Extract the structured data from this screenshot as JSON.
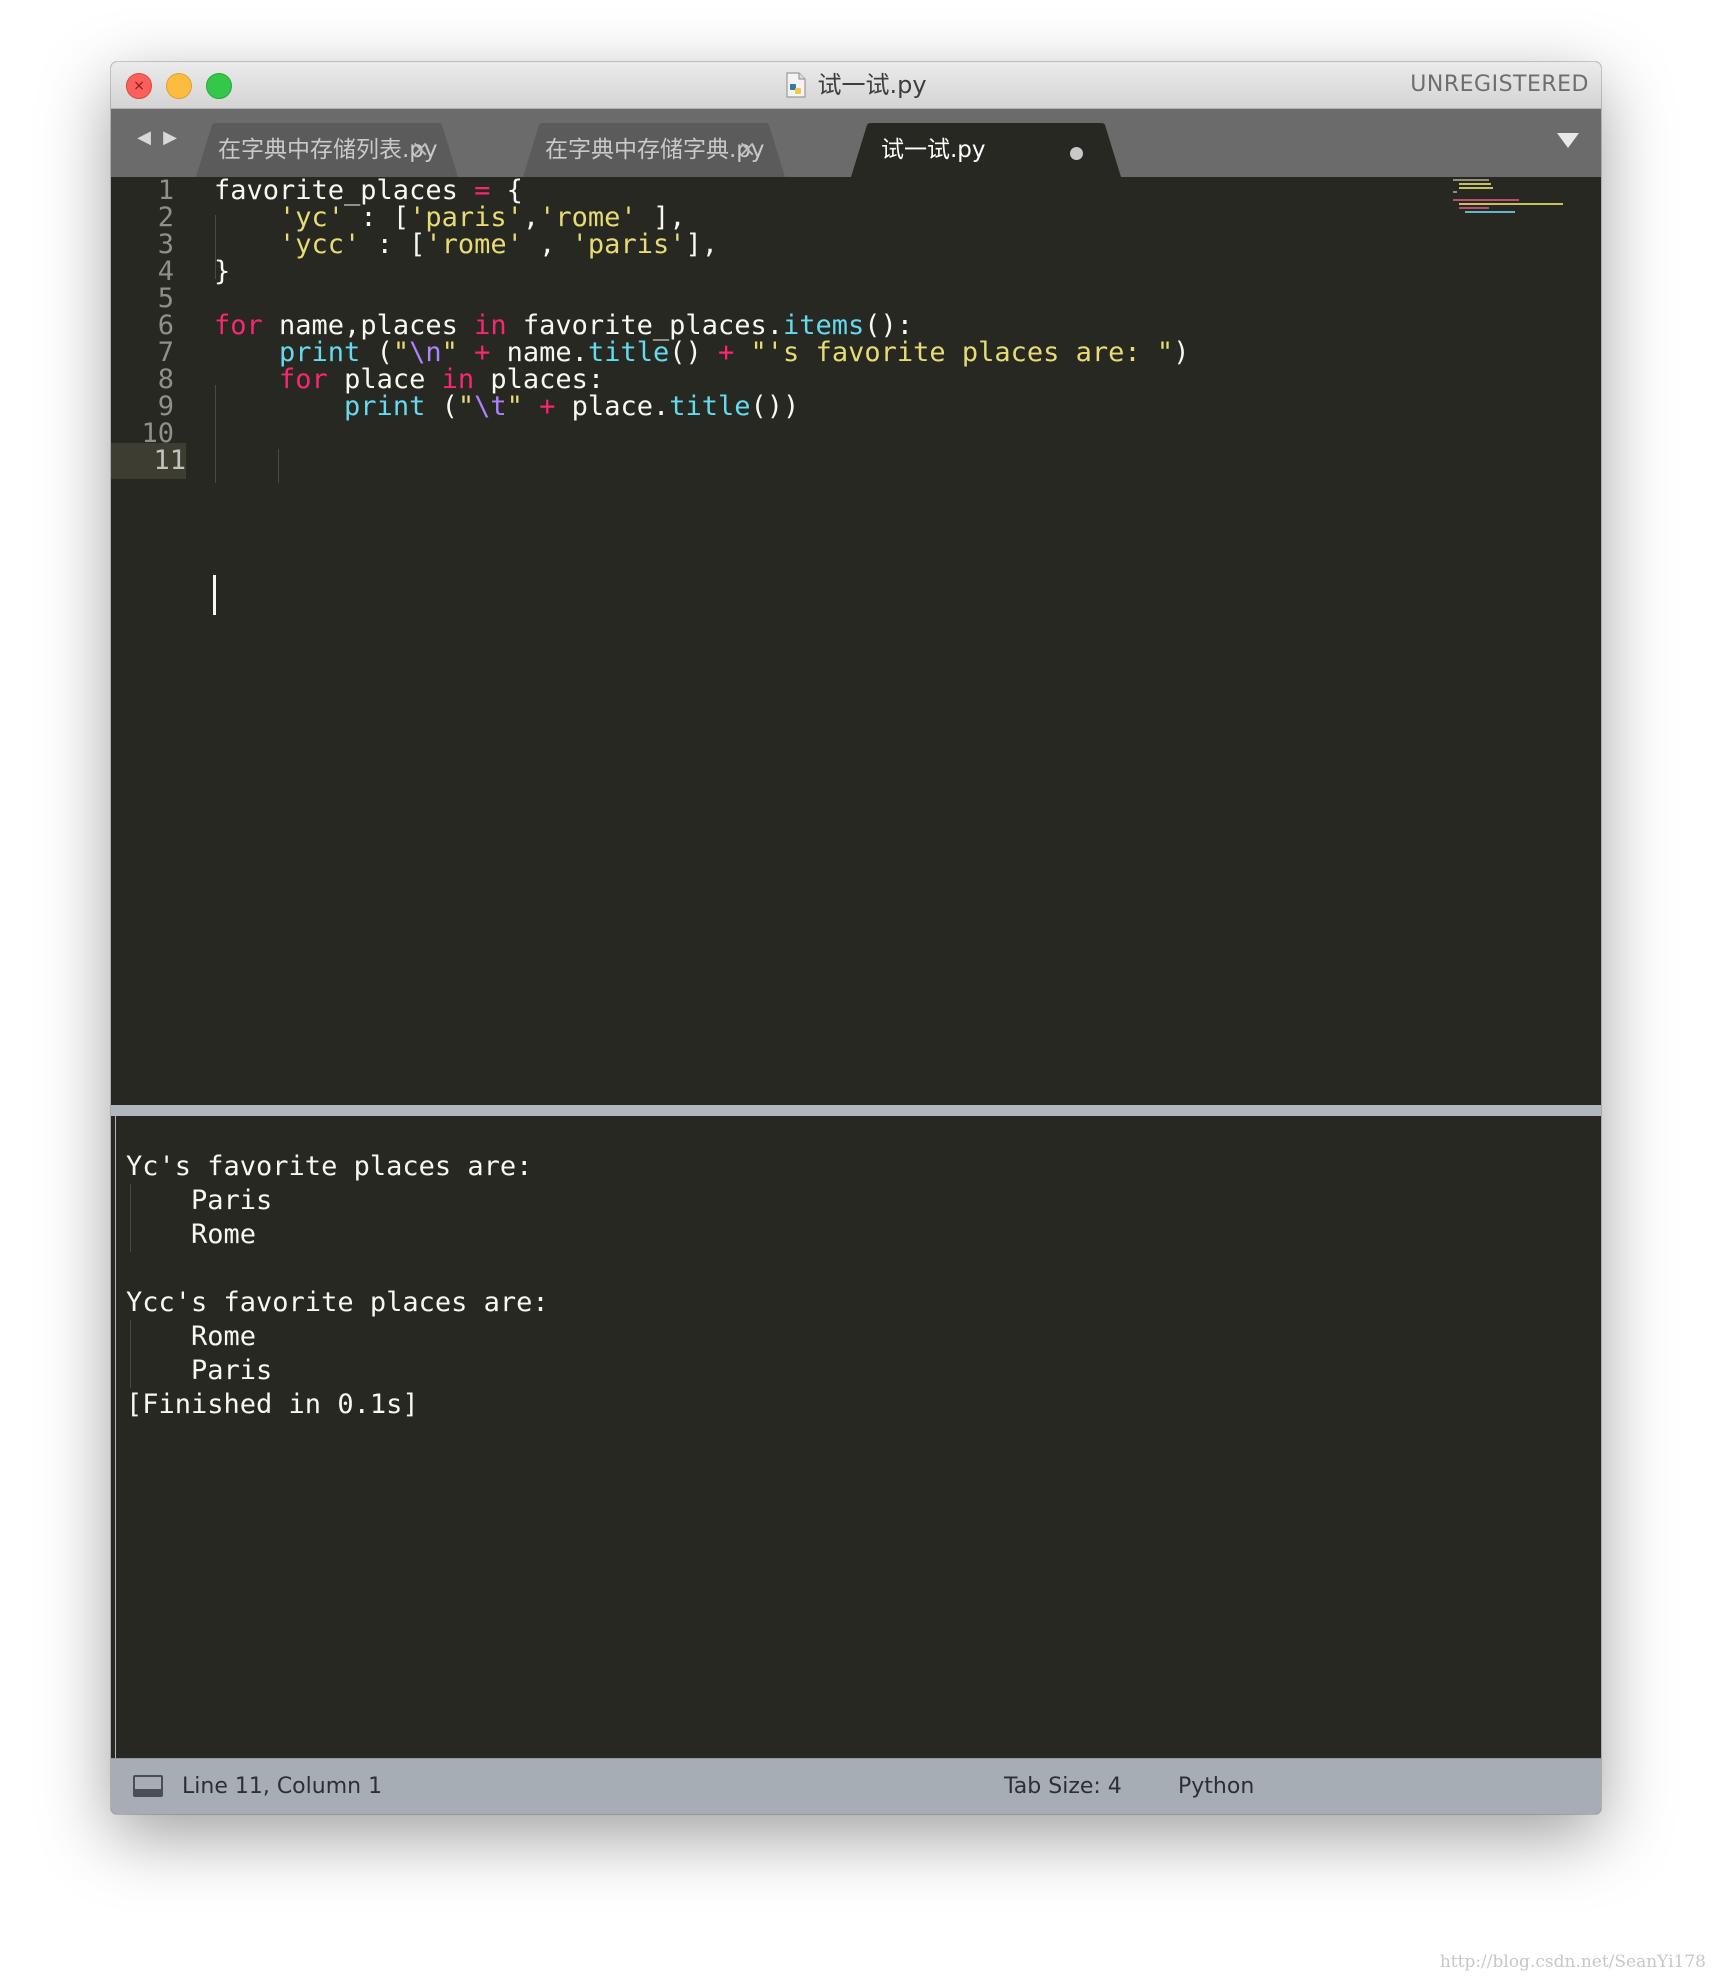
{
  "window": {
    "title": "试一试.py",
    "license_label": "UNREGISTERED"
  },
  "tabs": [
    {
      "label": "在字典中存储列表.py",
      "state": "inactive",
      "indicator": "×"
    },
    {
      "label": "在字典中存储字典.py",
      "state": "inactive",
      "indicator": "×"
    },
    {
      "label": "试一试.py",
      "state": "active",
      "indicator": "unsaved-dot"
    }
  ],
  "nav": {
    "back": "◀",
    "forward": "▶"
  },
  "editor": {
    "line_numbers": [
      "1",
      "2",
      "3",
      "4",
      "5",
      "6",
      "7",
      "8",
      "9",
      "10",
      "11"
    ],
    "current_line": 11,
    "lines": [
      [
        {
          "t": "favorite_places ",
          "c": "txt"
        },
        {
          "t": "=",
          "c": "op"
        },
        {
          "t": " {",
          "c": "txt"
        }
      ],
      [
        {
          "t": "    ",
          "c": "txt"
        },
        {
          "t": "'yc'",
          "c": "st"
        },
        {
          "t": " : [",
          "c": "txt"
        },
        {
          "t": "'paris'",
          "c": "st"
        },
        {
          "t": ",",
          "c": "txt"
        },
        {
          "t": "'rome'",
          "c": "st"
        },
        {
          "t": " ],",
          "c": "txt"
        }
      ],
      [
        {
          "t": "    ",
          "c": "txt"
        },
        {
          "t": "'ycc'",
          "c": "st"
        },
        {
          "t": " : [",
          "c": "txt"
        },
        {
          "t": "'rome'",
          "c": "st"
        },
        {
          "t": " , ",
          "c": "txt"
        },
        {
          "t": "'paris'",
          "c": "st"
        },
        {
          "t": "],",
          "c": "txt"
        }
      ],
      [
        {
          "t": "}",
          "c": "txt"
        }
      ],
      [],
      [
        {
          "t": "for",
          "c": "kw"
        },
        {
          "t": " name,places ",
          "c": "txt"
        },
        {
          "t": "in",
          "c": "kw"
        },
        {
          "t": " favorite_places.",
          "c": "txt"
        },
        {
          "t": "items",
          "c": "fn"
        },
        {
          "t": "():",
          "c": "txt"
        }
      ],
      [
        {
          "t": "    ",
          "c": "txt"
        },
        {
          "t": "print",
          "c": "fn"
        },
        {
          "t": " (",
          "c": "txt"
        },
        {
          "t": "\"",
          "c": "st"
        },
        {
          "t": "\\n",
          "c": "es"
        },
        {
          "t": "\"",
          "c": "st"
        },
        {
          "t": " ",
          "c": "txt"
        },
        {
          "t": "+",
          "c": "op"
        },
        {
          "t": " name.",
          "c": "txt"
        },
        {
          "t": "title",
          "c": "fn"
        },
        {
          "t": "() ",
          "c": "txt"
        },
        {
          "t": "+",
          "c": "op"
        },
        {
          "t": " ",
          "c": "txt"
        },
        {
          "t": "\"'s favorite places are: \"",
          "c": "st"
        },
        {
          "t": ")",
          "c": "txt"
        }
      ],
      [
        {
          "t": "    ",
          "c": "txt"
        },
        {
          "t": "for",
          "c": "kw"
        },
        {
          "t": " place ",
          "c": "txt"
        },
        {
          "t": "in",
          "c": "kw"
        },
        {
          "t": " places:",
          "c": "txt"
        }
      ],
      [
        {
          "t": "        ",
          "c": "txt"
        },
        {
          "t": "print",
          "c": "fn"
        },
        {
          "t": " (",
          "c": "txt"
        },
        {
          "t": "\"",
          "c": "st"
        },
        {
          "t": "\\t",
          "c": "es"
        },
        {
          "t": "\"",
          "c": "st"
        },
        {
          "t": " ",
          "c": "txt"
        },
        {
          "t": "+",
          "c": "op"
        },
        {
          "t": " place.",
          "c": "txt"
        },
        {
          "t": "title",
          "c": "fn"
        },
        {
          "t": "())",
          "c": "txt"
        }
      ],
      [],
      []
    ]
  },
  "output": {
    "lines": [
      "",
      "Yc's favorite places are:",
      "    Paris",
      "    Rome",
      "",
      "Ycc's favorite places are:",
      "    Rome",
      "    Paris",
      "[Finished in 0.1s]"
    ]
  },
  "statusbar": {
    "position": "Line 11, Column 1",
    "tab_size": "Tab Size: 4",
    "syntax": "Python"
  },
  "watermark": "http://blog.csdn.net/SeanYi178",
  "colors": {
    "editor_bg": "#272822",
    "keyword": "#f92672",
    "function": "#66d9ef",
    "string": "#e6db74",
    "escape": "#ae81ff",
    "text": "#f8f8f2",
    "line_number": "#90908a"
  }
}
